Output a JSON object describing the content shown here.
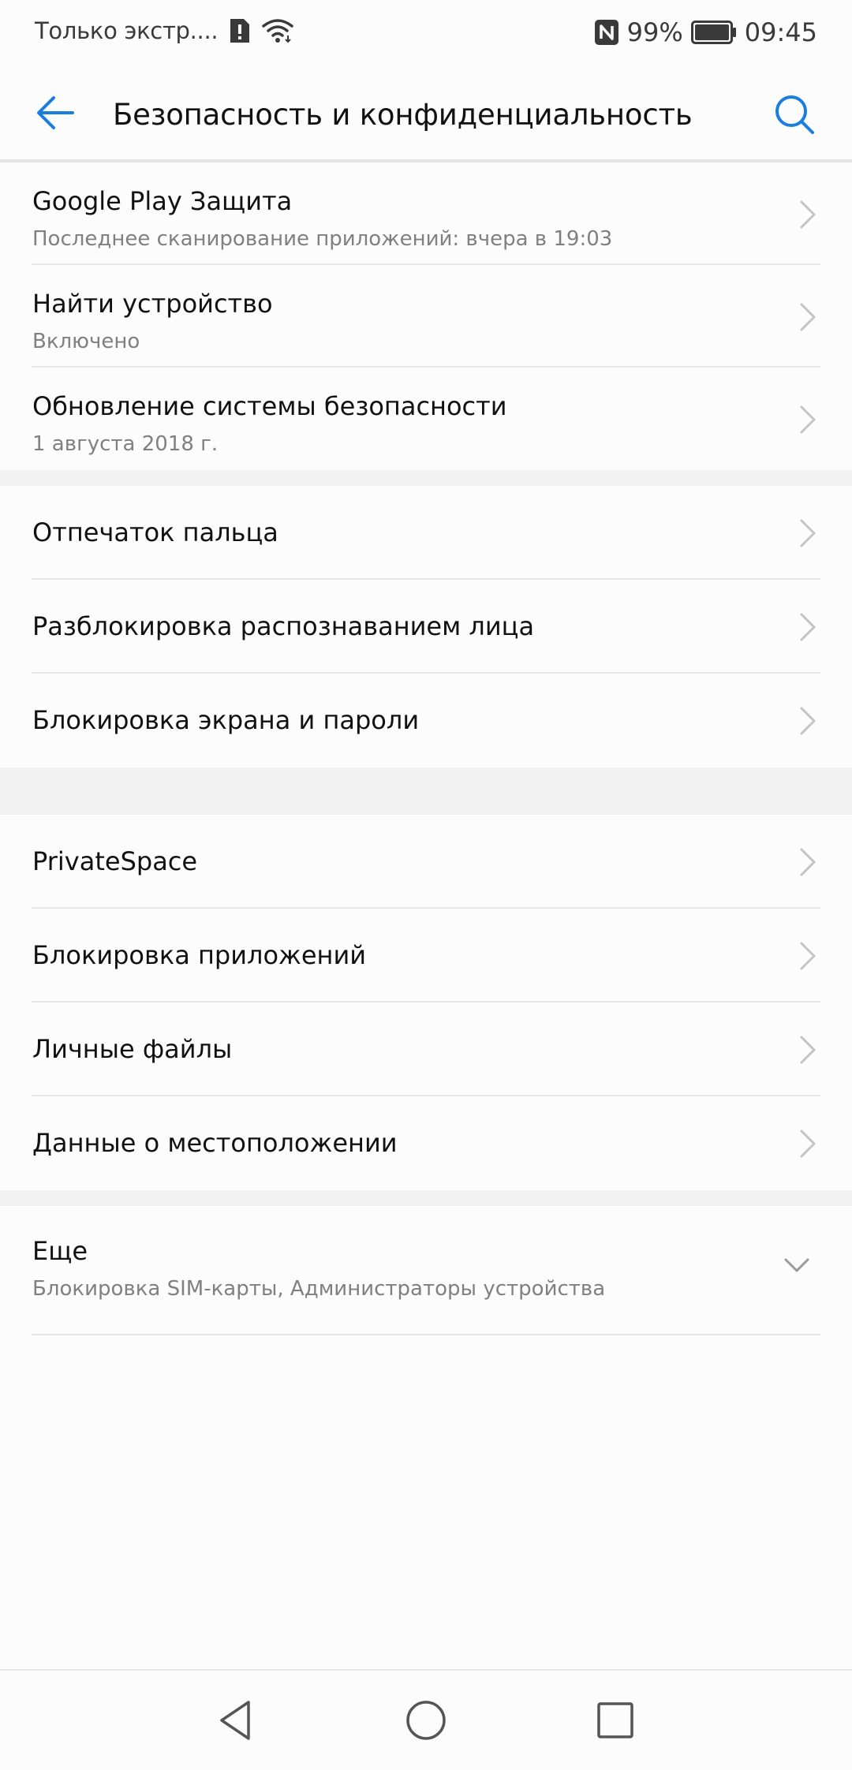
{
  "status_bar": {
    "carrier": "Только экстр....",
    "battery": "99%",
    "time": "09:45"
  },
  "header": {
    "title": "Безопасность и конфиденциальность",
    "back_icon": "arrow-left-icon",
    "search_icon": "search-icon"
  },
  "colors": {
    "accent": "#1a7de0",
    "text_primary": "#111111",
    "text_secondary": "#808080",
    "separator": "#f2f2f2"
  },
  "group1": [
    {
      "title": "Google Play Защита",
      "subtitle": "Последнее сканирование приложений: вчера в 19:03"
    },
    {
      "title": "Найти устройство",
      "subtitle": "Включено"
    },
    {
      "title": "Обновление системы безопасности",
      "subtitle": "1 августа 2018 г."
    }
  ],
  "group2": [
    {
      "title": "Отпечаток пальца"
    },
    {
      "title": "Разблокировка распознаванием лица"
    },
    {
      "title": "Блокировка экрана и пароли"
    }
  ],
  "group3": [
    {
      "title": "PrivateSpace"
    },
    {
      "title": "Блокировка приложений"
    },
    {
      "title": "Личные файлы"
    },
    {
      "title": "Данные о местоположении"
    }
  ],
  "more": {
    "title": "Еще",
    "subtitle": "Блокировка SIM-карты, Администраторы устройства"
  },
  "nav": {
    "back_icon": "triangle-back-icon",
    "home_icon": "circle-home-icon",
    "recent_icon": "square-recent-icon"
  }
}
